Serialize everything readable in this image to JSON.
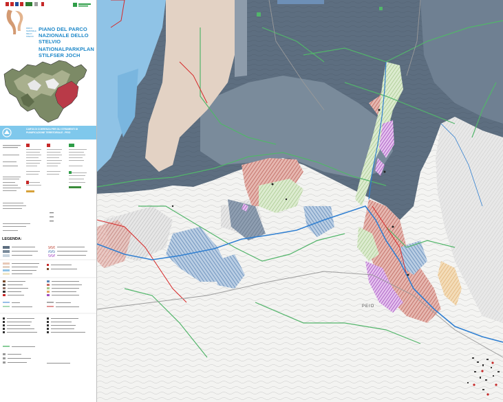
{
  "header": {
    "title_it_line1": "PIANO DEL PARCO",
    "title_it_line2": "NAZIONALE DELLO STELVIO",
    "title_de_line1": "NATIONALPARKPLAN",
    "title_de_line2": "STILFSER JOCH",
    "banner_line1": "CARTA DI COERENZA PER GLI STRUMENTI DI",
    "banner_line2": "PIANIFICAZIONE TERRITORIALE - PEIO"
  },
  "legend": {
    "title": "LEGENDA:"
  },
  "map": {
    "place_label": "PEIO",
    "colors": {
      "zone_dark": "#5d6e80",
      "zone_mid": "#7a8b9b",
      "zone_light_blue": "#8fc3e6",
      "zone_tan": "#e3d2c4",
      "hatch_red": "#c8685e",
      "hatch_green": "#a6c98a",
      "hatch_blue": "#5b86b5",
      "hatch_purple": "#a24fbf",
      "hatch_orange": "#e0a861",
      "boundary_green": "#52b56a",
      "boundary_red": "#d62828",
      "river": "#2f7fd1"
    }
  },
  "icons": [
    "regional-coat-of-arms-icon",
    "park-logo-icon",
    "regional-logo-icon"
  ]
}
